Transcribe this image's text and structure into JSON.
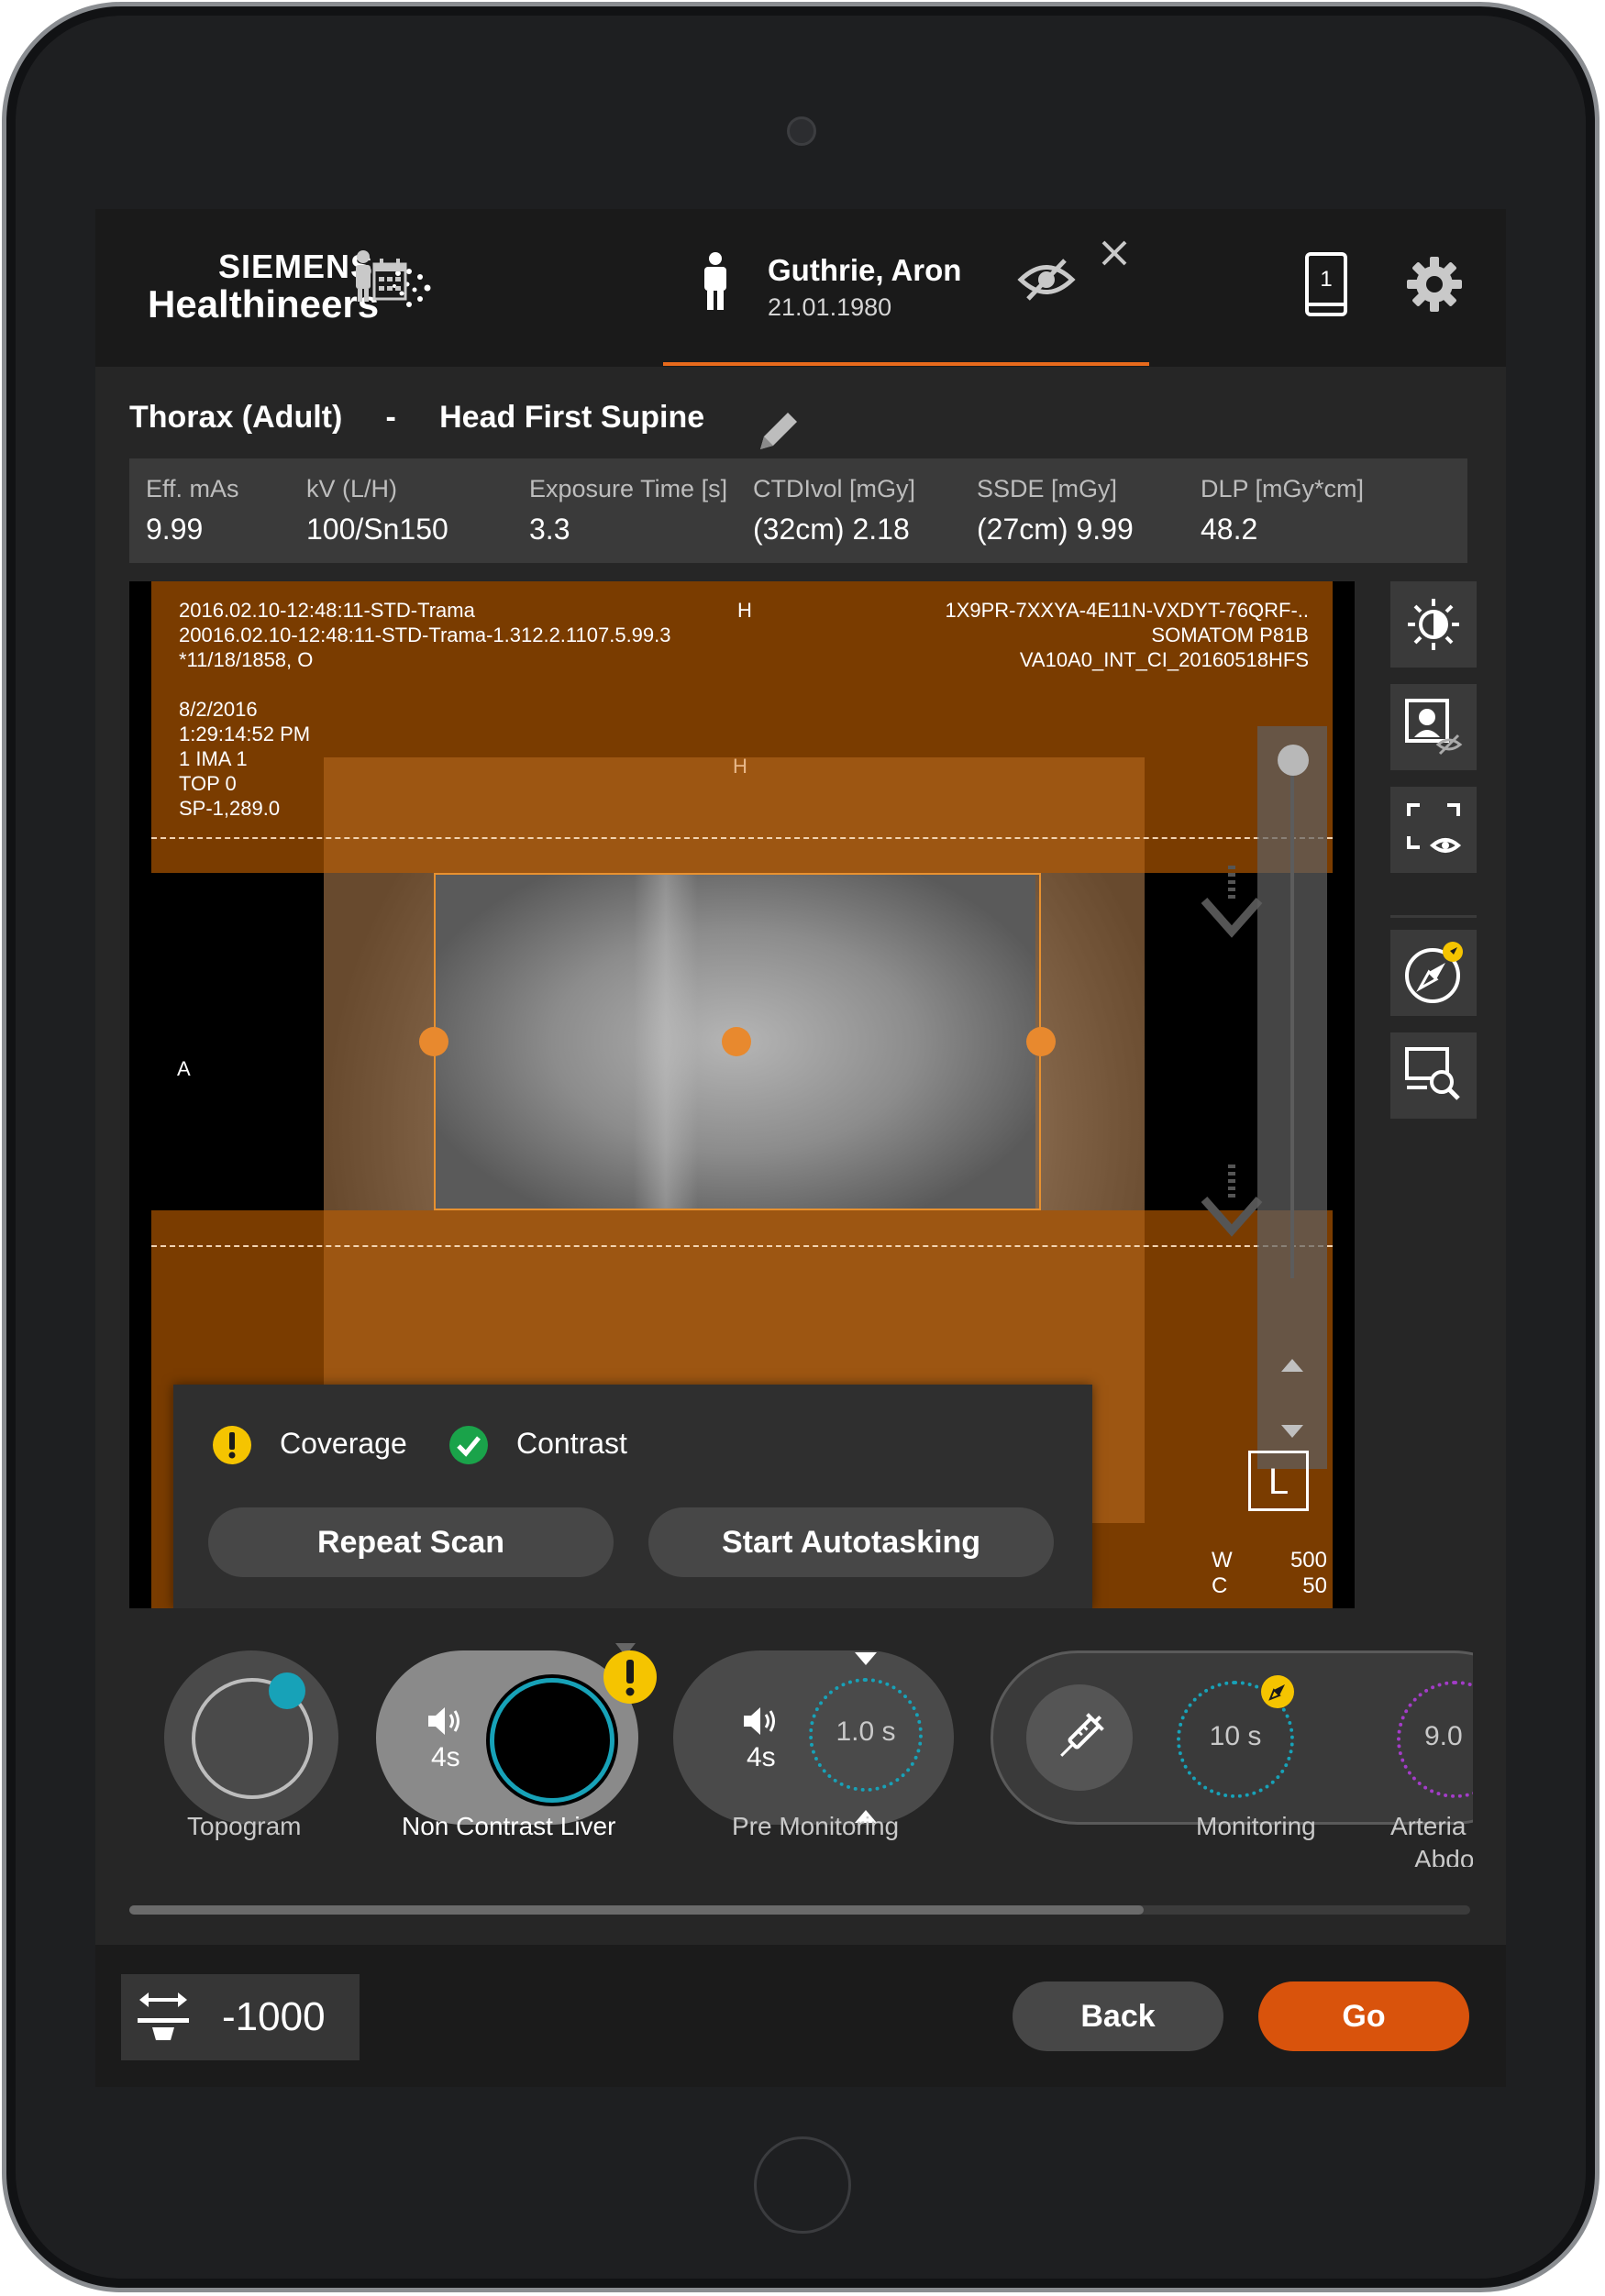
{
  "brand": {
    "line1": "SIEMENS",
    "line2": "Healthineers"
  },
  "patient": {
    "name": "Guthrie, Aron",
    "dob": "21.01.1980"
  },
  "protocol": {
    "region": "Thorax (Adult)",
    "separator": "-",
    "position": "Head First Supine"
  },
  "params": [
    {
      "label": "Eff. mAs",
      "value": "9.99"
    },
    {
      "label": "kV (L/H)",
      "value": "100/Sn150"
    },
    {
      "label": "Exposure Time [s]",
      "value": "3.3"
    },
    {
      "label": "CTDIvol [mGy]",
      "value": "(32cm) 2.18"
    },
    {
      "label": "SSDE [mGy]",
      "value": "(27cm) 9.99"
    },
    {
      "label": "DLP [mGy*cm]",
      "value": "48.2"
    }
  ],
  "viewer": {
    "info_left": "2016.02.10-12:48:11-STD-Trama\n20016.02.10-12:48:11-STD-Trama-1.312.2.1107.5.99.3\n*11/18/1858, O\n\n8/2/2016\n1:29:14:52 PM\n1 IMA 1\nTOP 0\nSP-1,289.0",
    "info_center": "H",
    "info_center_top": "H",
    "info_right": "1X9PR-7XXYA-4E11N-VXDYT-76QRF-..\nSOMATOM P81B\nVA10A0_INT_CI_20160518HFS",
    "orientation_left": "A",
    "laterality": "L",
    "window_label_w": "W",
    "window_value_w": "500",
    "window_label_c": "C",
    "window_value_c": "50"
  },
  "popup": {
    "coverage_label": "Coverage",
    "contrast_label": "Contrast",
    "repeat_label": "Repeat Scan",
    "autotask_label": "Start Autotasking"
  },
  "steps": [
    {
      "label": "Topogram"
    },
    {
      "label": "Non Contrast Liver",
      "delay": "4s"
    },
    {
      "label": "Pre Monitoring",
      "delay": "4s",
      "time": "1.0 s"
    },
    {
      "label": "Monitoring",
      "time": "10 s"
    },
    {
      "label_line1": "Arteria",
      "label_line2": "Abdo",
      "time": "9.0"
    }
  ],
  "bottom": {
    "table_value": "-1000",
    "back_label": "Back",
    "go_label": "Go"
  },
  "colors": {
    "accent": "#e86a1c",
    "go": "#d9530c",
    "overlay": "#7a3c00",
    "warning": "#f5c400",
    "ok": "#1aa34a",
    "teal": "#17a2b8",
    "purple": "#a33cc8"
  }
}
